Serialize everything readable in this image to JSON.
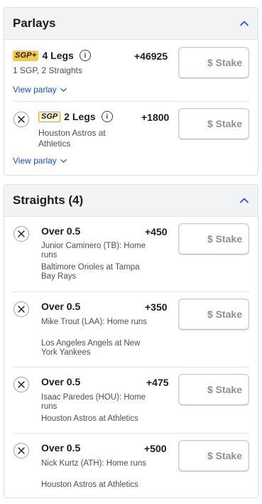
{
  "parlays": {
    "title": "Parlays",
    "items": [
      {
        "badge": "SGP+",
        "legs": "4 Legs",
        "info": "i",
        "description": "1 SGP, 2 Straights",
        "odds": "+46925",
        "stake_placeholder": "$ Stake",
        "view_label": "View parlay"
      },
      {
        "badge": "SGP",
        "legs": "2 Legs",
        "info": "i",
        "description": "Houston Astros at Athletics",
        "odds": "+1800",
        "stake_placeholder": "$ Stake",
        "view_label": "View parlay"
      }
    ]
  },
  "straights": {
    "title": "Straights (4)",
    "items": [
      {
        "selection": "Over 0.5",
        "market": "Junior Caminero (TB): Home runs",
        "event": "Baltimore Orioles at Tampa Bay Rays",
        "odds": "+450",
        "stake_placeholder": "$ Stake"
      },
      {
        "selection": "Over 0.5",
        "market": "Mike Trout (LAA): Home runs",
        "event": "Los Angeles Angels at New York Yankees",
        "odds": "+350",
        "stake_placeholder": "$ Stake"
      },
      {
        "selection": "Over 0.5",
        "market": "Isaac Paredes (HOU): Home runs",
        "event": "Houston Astros at Athletics",
        "odds": "+475",
        "stake_placeholder": "$ Stake"
      },
      {
        "selection": "Over 0.5",
        "market": "Nick Kurtz (ATH): Home runs",
        "event": "Houston Astros at Athletics",
        "odds": "+500",
        "stake_placeholder": "$ Stake"
      }
    ]
  },
  "colors": {
    "link": "#1a4fd6",
    "header_bg": "#f2f3f5",
    "sgp_plus_badge": "#f7c948",
    "stake_text": "#8b9099"
  },
  "icons": {
    "collapse": "chevron-up-icon",
    "expand": "chevron-down-icon",
    "remove": "close-icon",
    "info": "info-icon"
  }
}
